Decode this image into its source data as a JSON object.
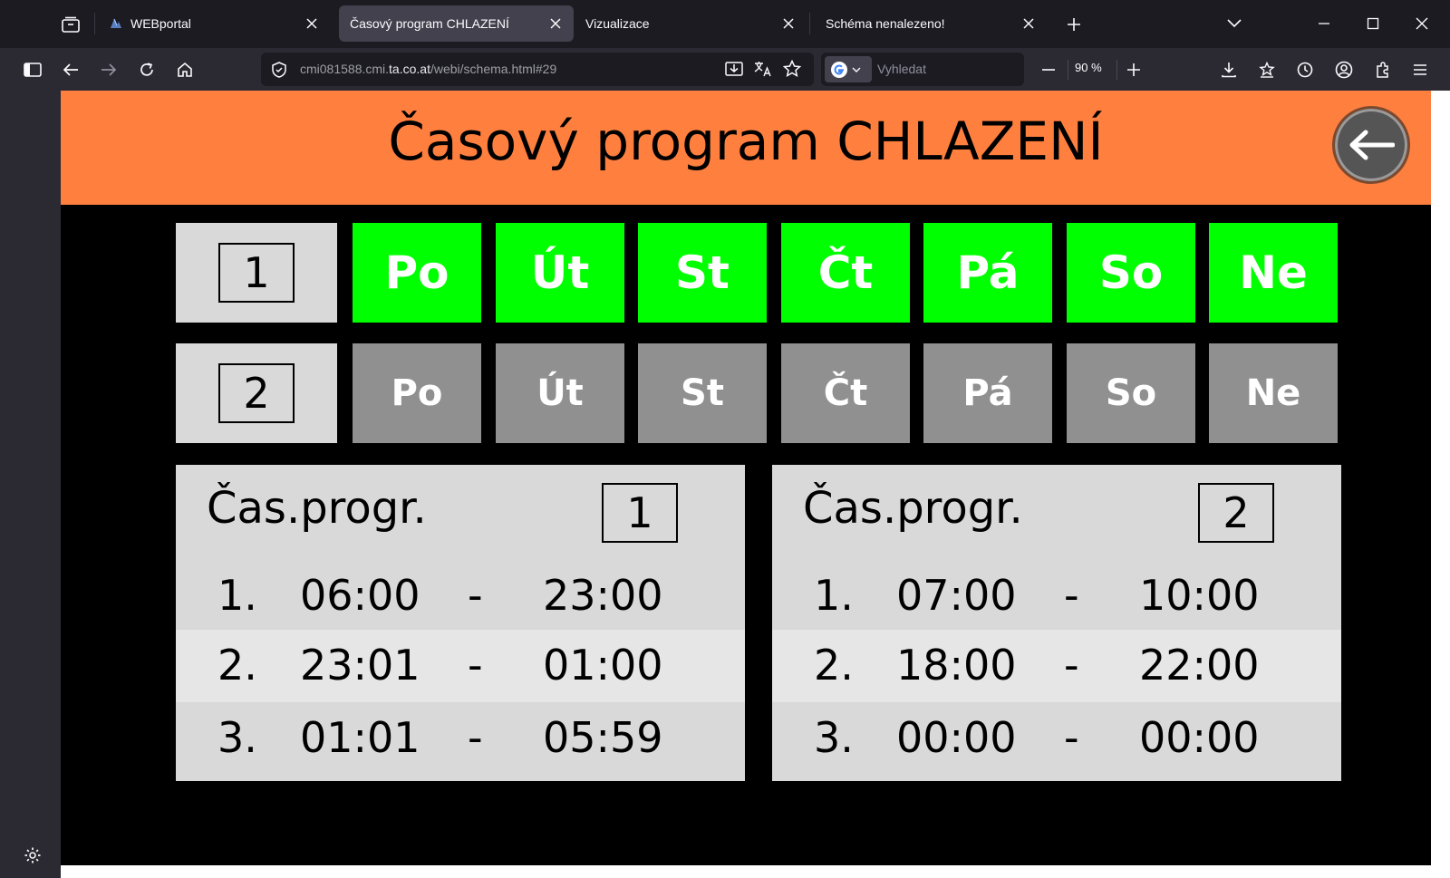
{
  "browser": {
    "tabs": [
      {
        "label": "WEBportal",
        "active": false
      },
      {
        "label": "Časový program CHLAZENÍ",
        "active": true
      },
      {
        "label": "Vizualizace",
        "active": false
      },
      {
        "label": "Schéma nenalezeno!",
        "active": false
      }
    ],
    "url_prefix": "cmi081588.cmi.",
    "url_domain": "ta.co.at",
    "url_path": "/webi/schema.html#29",
    "search_placeholder": "Vyhledat",
    "zoom": "90 %"
  },
  "page": {
    "title": "Časový program CHLAZENÍ",
    "accent_color": "#ff7f3f",
    "day_active_color": "#00ff00",
    "day_inactive_color": "#909090",
    "rows": [
      {
        "number": "1",
        "days": [
          {
            "label": "Po",
            "active": true
          },
          {
            "label": "Út",
            "active": true
          },
          {
            "label": "St",
            "active": true
          },
          {
            "label": "Čt",
            "active": true
          },
          {
            "label": "Pá",
            "active": true
          },
          {
            "label": "So",
            "active": true
          },
          {
            "label": "Ne",
            "active": true
          }
        ]
      },
      {
        "number": "2",
        "days": [
          {
            "label": "Po",
            "active": false
          },
          {
            "label": "Út",
            "active": false
          },
          {
            "label": "St",
            "active": false
          },
          {
            "label": "Čt",
            "active": false
          },
          {
            "label": "Pá",
            "active": false
          },
          {
            "label": "So",
            "active": false
          },
          {
            "label": "Ne",
            "active": false
          }
        ]
      }
    ],
    "programs": [
      {
        "title": "Čas.progr.",
        "number": "1",
        "slots": [
          {
            "index": "1.",
            "from": "06:00",
            "dash": "-",
            "to": "23:00"
          },
          {
            "index": "2.",
            "from": "23:01",
            "dash": "-",
            "to": "01:00"
          },
          {
            "index": "3.",
            "from": "01:01",
            "dash": "-",
            "to": "05:59"
          }
        ]
      },
      {
        "title": "Čas.progr.",
        "number": "2",
        "slots": [
          {
            "index": "1.",
            "from": "07:00",
            "dash": "-",
            "to": "10:00"
          },
          {
            "index": "2.",
            "from": "18:00",
            "dash": "-",
            "to": "22:00"
          },
          {
            "index": "3.",
            "from": "00:00",
            "dash": "-",
            "to": "00:00"
          }
        ]
      }
    ]
  }
}
